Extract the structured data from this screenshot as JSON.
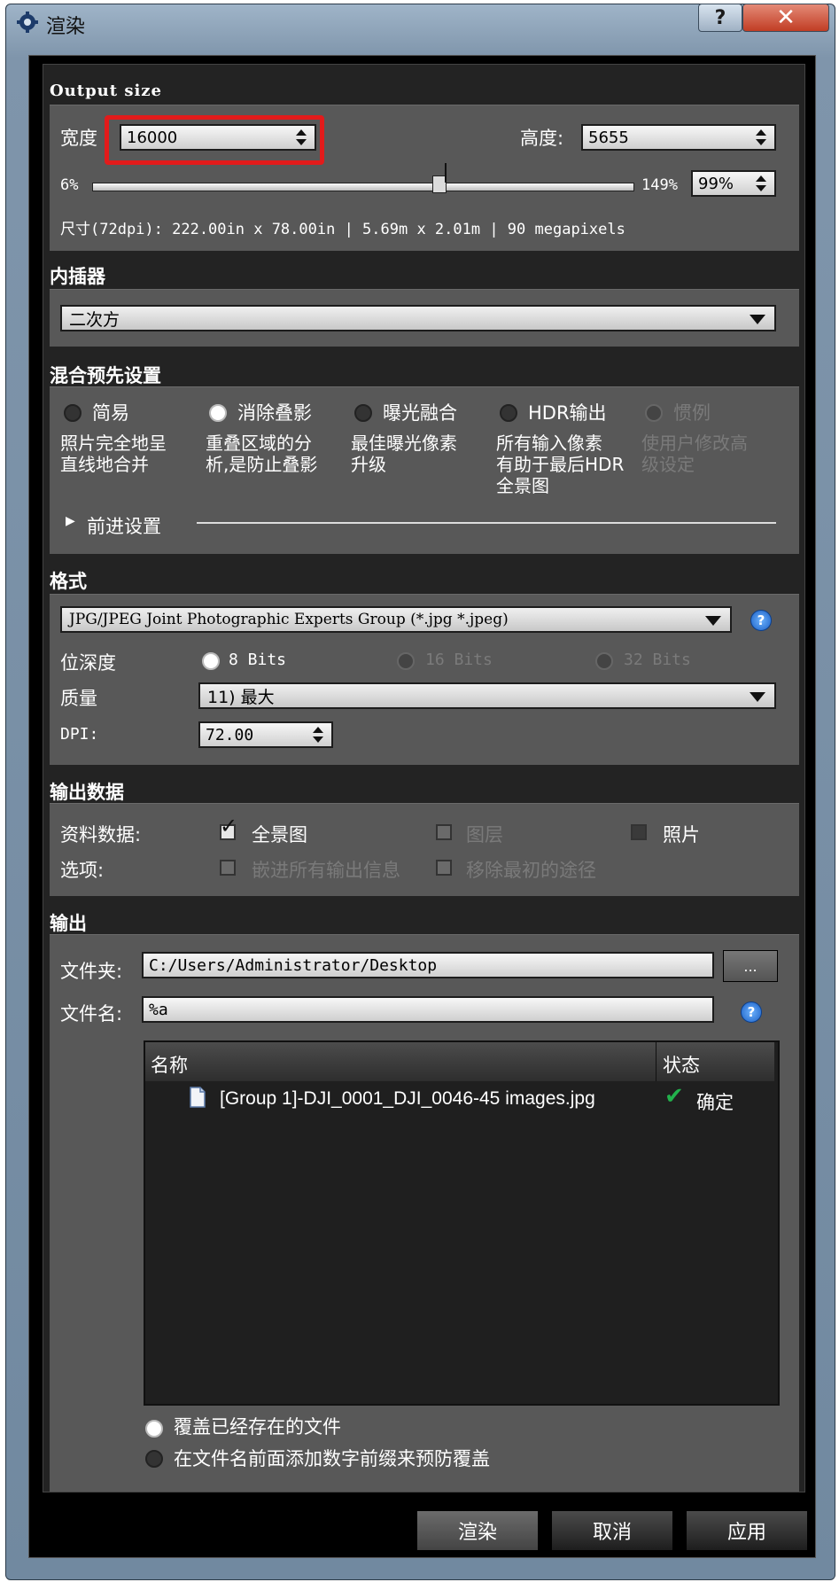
{
  "window": {
    "title": "渲染",
    "help_label": "?",
    "close_label": "✕"
  },
  "output_size": {
    "title": "Output size",
    "width_label": "宽度",
    "width_value": "16000",
    "height_label": "高度:",
    "height_value": "5655",
    "scale_min": "6%",
    "scale_max": "149%",
    "scale_value": "99%",
    "scale_fraction": 0.64,
    "dimensions": "尺寸(72dpi): 222.00in x 78.00in | 5.69m x 2.01m | 90 megapixels"
  },
  "interpolator": {
    "title": "内插器",
    "value": "二次方"
  },
  "blend_preset": {
    "title": "混合预先设置",
    "options": [
      {
        "label": "简易",
        "desc": [
          "照片完全地呈",
          "直线地合并"
        ],
        "state": "dark"
      },
      {
        "label": "消除叠影",
        "desc": [
          "重叠区域的分",
          "析,是防止叠影"
        ],
        "state": "on"
      },
      {
        "label": "曝光融合",
        "desc": [
          "最佳曝光像素",
          "升级"
        ],
        "state": "dark"
      },
      {
        "label": "HDR输出",
        "desc": [
          "所有输入像素",
          "有助于最后HDR",
          "全景图"
        ],
        "state": "dark"
      },
      {
        "label": "惯例",
        "desc": [
          "使用户修改高",
          "级设定"
        ],
        "state": "disabled"
      }
    ],
    "advanced_label": "前进设置"
  },
  "format": {
    "title": "格式",
    "type_value": "JPG/JPEG Joint Photographic Experts Group (*.jpg *.jpeg)",
    "bit_depth_label": "位深度",
    "bit_options": [
      "8 Bits",
      "16 Bits",
      "32 Bits"
    ],
    "quality_label": "质量",
    "quality_value": "11) 最大",
    "dpi_label": "DPI:",
    "dpi_value": "72.00"
  },
  "output_data": {
    "title": "输出数据",
    "data_label": "资料数据:",
    "data_options": [
      "全景图",
      "图层",
      "照片"
    ],
    "options_label": "选项:",
    "option_items": [
      "嵌进所有输出信息",
      "移除最初的途径"
    ]
  },
  "output": {
    "title": "输出",
    "folder_label": "文件夹:",
    "folder_value": "C:/Users/Administrator/Desktop",
    "browse_label": "...",
    "filename_label": "文件名:",
    "filename_value": "%a",
    "table": {
      "col_name": "名称",
      "col_status": "状态",
      "rows": [
        {
          "name": "[Group 1]-DJI_0001_DJI_0046-45 images.jpg",
          "status": "确定"
        }
      ]
    },
    "overwrite_label": "覆盖已经存在的文件",
    "prefix_label": "在文件名前面添加数字前缀来预防覆盖"
  },
  "buttons": {
    "render": "渲染",
    "cancel": "取消",
    "apply": "应用"
  },
  "colors": {
    "highlight": "#e21b1b",
    "check_green": "#22b14c",
    "help_blue": "#1b5fc4"
  }
}
